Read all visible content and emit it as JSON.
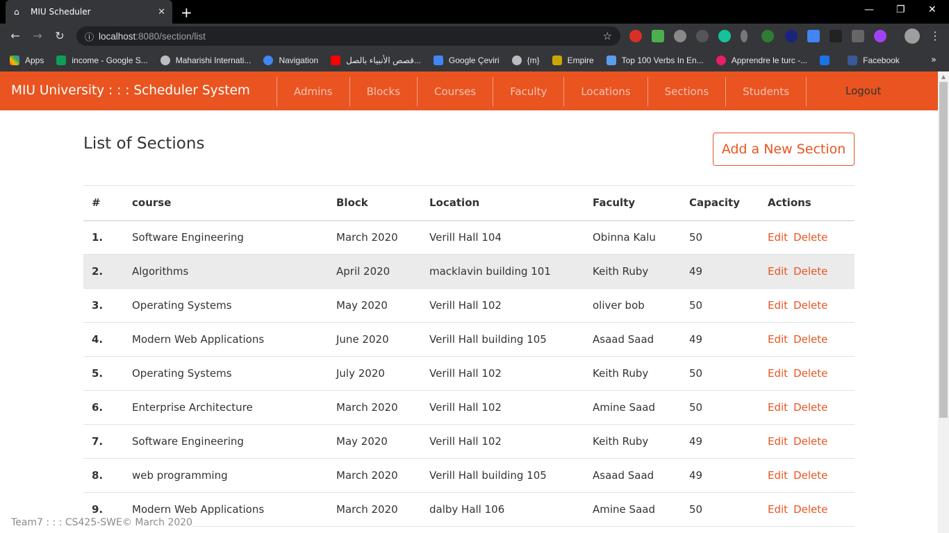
{
  "browser": {
    "tab_title": "MIU Scheduler",
    "url_host": "localhost",
    "url_rest": ":8080/section/list",
    "bookmarks": [
      "Apps",
      "income - Google S...",
      "Maharishi Internati...",
      "Navigation",
      "قصص الأنبياء بالصل...",
      "Google Çeviri",
      "{m}",
      "Empire",
      "Top 100 Verbs In En...",
      "Apprendre le turc -...",
      "Facebook"
    ]
  },
  "nav": {
    "brand": "MIU University : : : Scheduler System",
    "links": [
      "Admins",
      "Blocks",
      "Courses",
      "Faculty",
      "Locations",
      "Sections",
      "Students"
    ],
    "logout": "Logout"
  },
  "page": {
    "title": "List of Sections",
    "add_button": "Add a New Section"
  },
  "table": {
    "headers": [
      "#",
      "course",
      "Block",
      "Location",
      "Faculty",
      "Capacity",
      "Actions"
    ],
    "edit_label": "Edit",
    "delete_label": "Delete",
    "rows": [
      {
        "num": "1.",
        "course": "Software Engineering",
        "block": "March 2020",
        "location": "Verill Hall 104",
        "faculty": "Obinna Kalu",
        "capacity": "50"
      },
      {
        "num": "2.",
        "course": "Algorithms",
        "block": "April 2020",
        "location": "macklavin building 101",
        "faculty": "Keith Ruby",
        "capacity": "49"
      },
      {
        "num": "3.",
        "course": "Operating Systems",
        "block": "May 2020",
        "location": "Verill Hall 102",
        "faculty": "oliver bob",
        "capacity": "50"
      },
      {
        "num": "4.",
        "course": "Modern Web Applications",
        "block": "June 2020",
        "location": "Verill Hall building 105",
        "faculty": "Asaad Saad",
        "capacity": "49"
      },
      {
        "num": "5.",
        "course": "Operating Systems",
        "block": "July 2020",
        "location": "Verill Hall 102",
        "faculty": "Keith Ruby",
        "capacity": "50"
      },
      {
        "num": "6.",
        "course": "Enterprise Architecture",
        "block": "March 2020",
        "location": "Verill Hall 102",
        "faculty": "Amine Saad",
        "capacity": "50"
      },
      {
        "num": "7.",
        "course": "Software Engineering",
        "block": "May 2020",
        "location": "Verill Hall 102",
        "faculty": "Keith Ruby",
        "capacity": "49"
      },
      {
        "num": "8.",
        "course": "web programming",
        "block": "March 2020",
        "location": "Verill Hall building 105",
        "faculty": "Asaad Saad",
        "capacity": "49"
      },
      {
        "num": "9.",
        "course": "Modern Web Applications",
        "block": "March 2020",
        "location": "dalby Hall 106",
        "faculty": "Amine Saad",
        "capacity": "50"
      }
    ]
  },
  "footer": "Team7 : : : CS425-SWE© March 2020",
  "colors": {
    "accent": "#e95420"
  }
}
